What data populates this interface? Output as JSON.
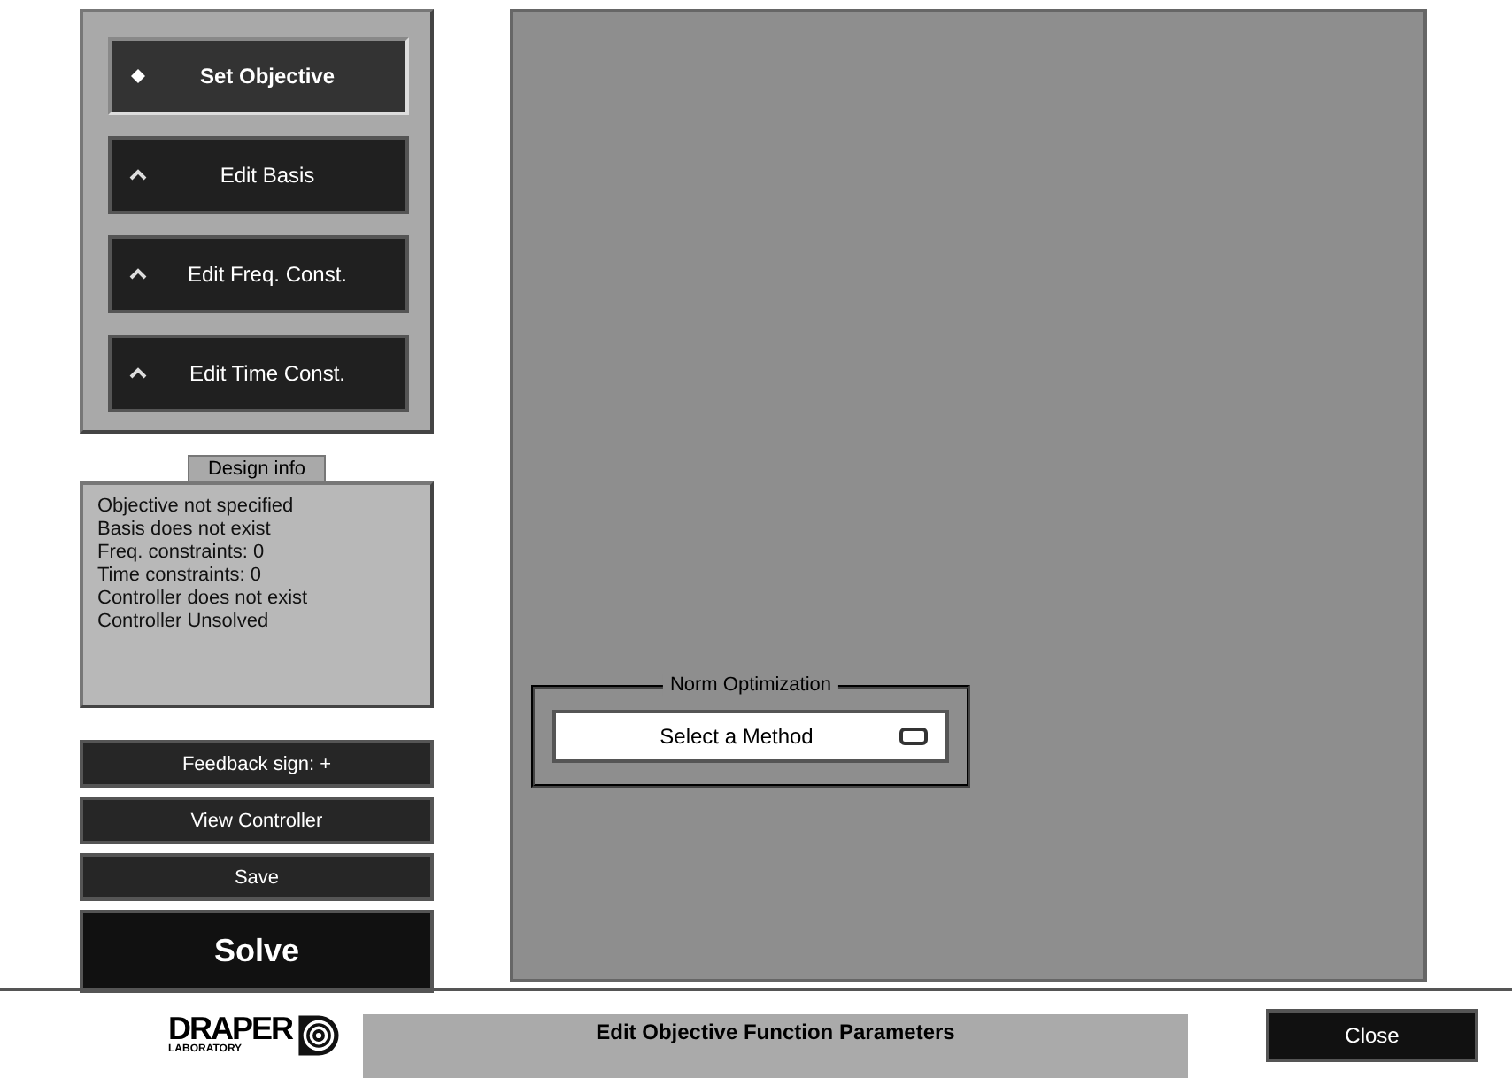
{
  "nav_buttons": [
    {
      "label": "Set Objective",
      "selected": true
    },
    {
      "label": "Edit Basis",
      "selected": false
    },
    {
      "label": "Edit Freq. Const.",
      "selected": false
    },
    {
      "label": "Edit Time Const.",
      "selected": false
    }
  ],
  "design_info": {
    "title": "Design info",
    "lines": [
      "Objective not specified",
      "Basis does not exist",
      "Freq. constraints: 0",
      "Time constraints: 0",
      "Controller does not exist",
      "Controller Unsolved"
    ]
  },
  "action_buttons": [
    {
      "label": "Feedback sign: +",
      "kind": "small"
    },
    {
      "label": "View Controller",
      "kind": "small"
    },
    {
      "label": "Save",
      "kind": "small"
    },
    {
      "label": "Solve",
      "kind": "large"
    }
  ],
  "norm_optimization": {
    "title": "Norm Optimization",
    "menu": "Select a Method"
  },
  "footer": {
    "logo": "DRAPER",
    "logo_sub": "LABORATORY",
    "title": "Edit Objective Function Parameters",
    "close": "Close"
  }
}
